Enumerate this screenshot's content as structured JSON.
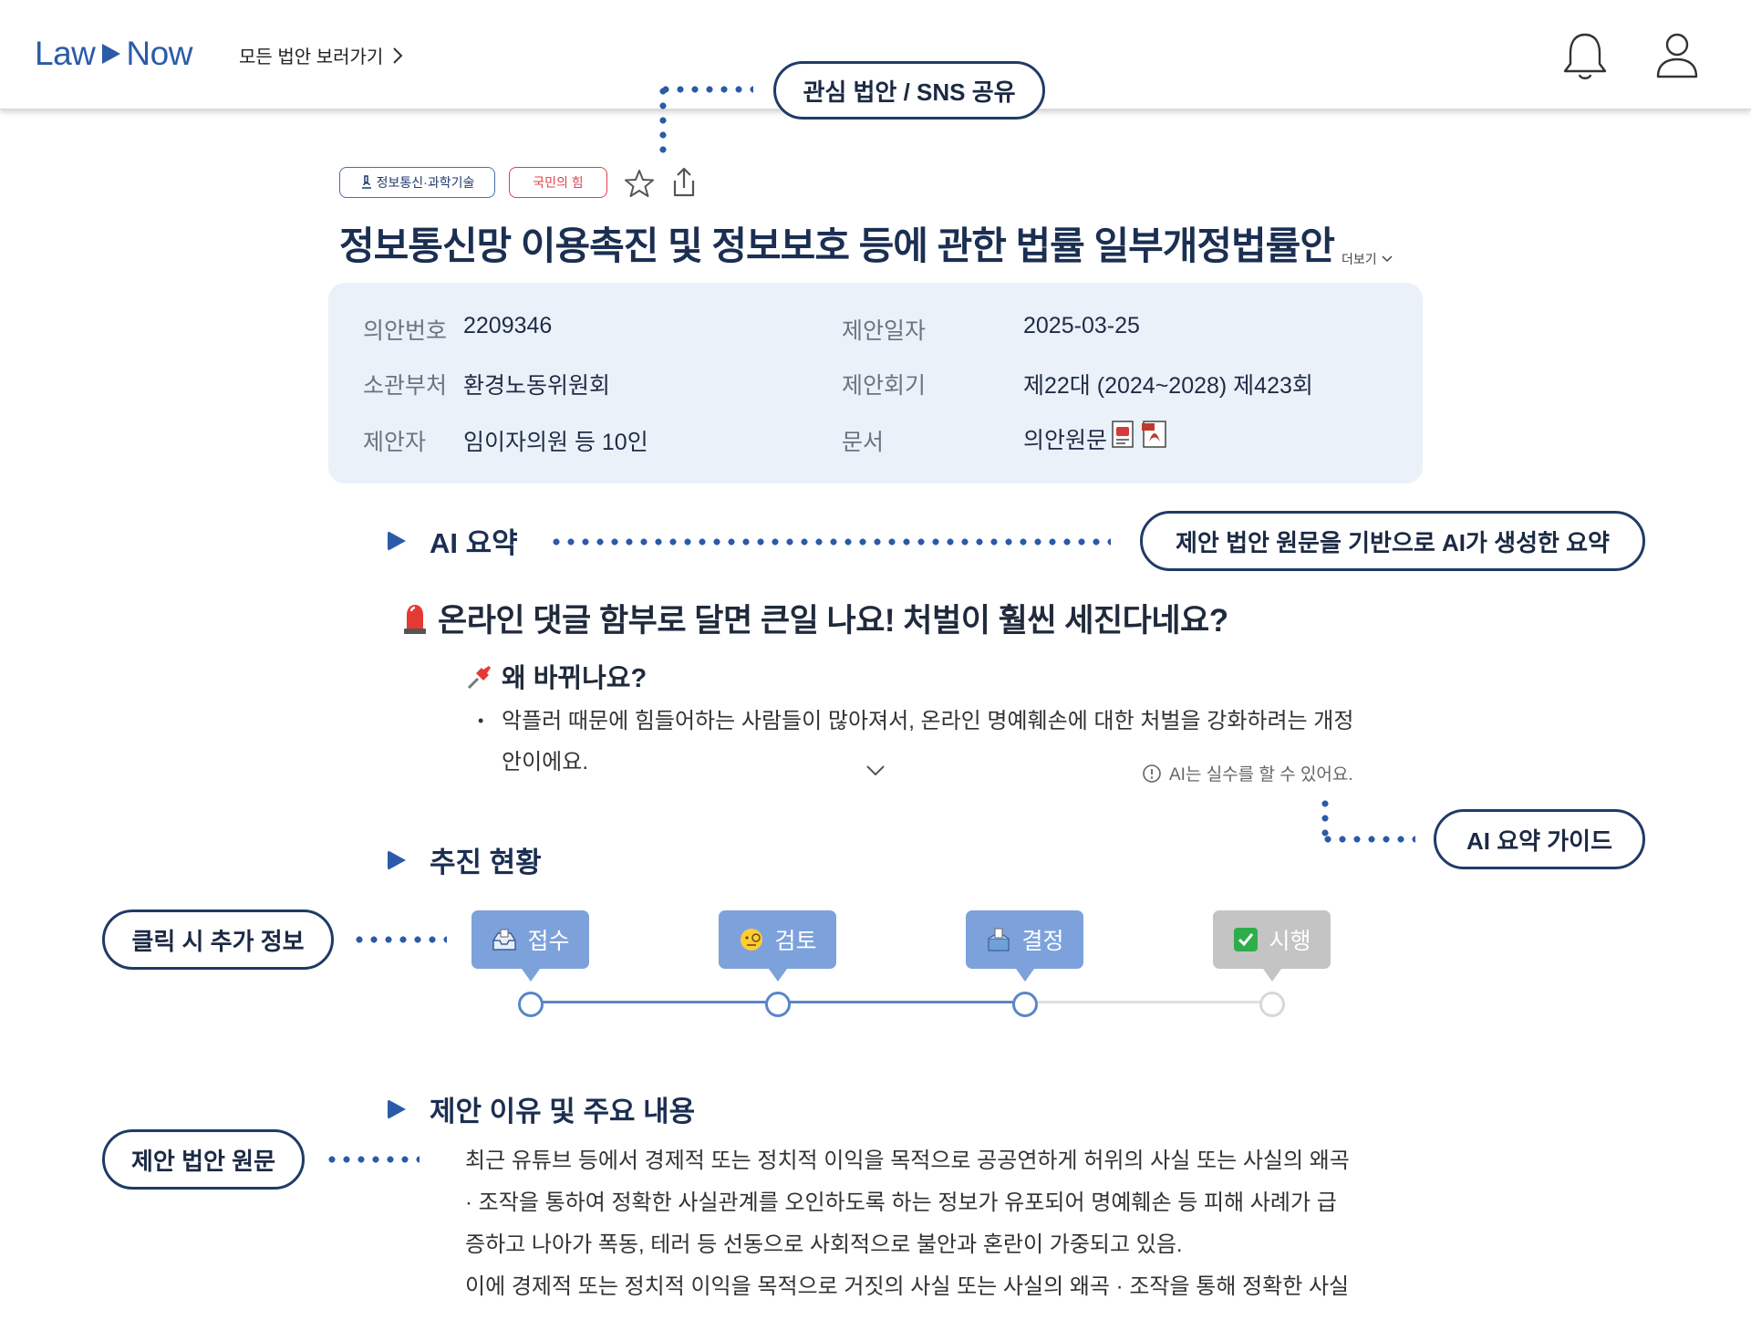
{
  "header": {
    "logo_left": "Law",
    "logo_right": "Now",
    "all_bills_label": "모든 법안 보러가기"
  },
  "callouts": {
    "share": "관심 법안 / SNS 공유",
    "ai_source": "제안 법안 원문을 기반으로 AI가 생성한 요약",
    "ai_guide": "AI 요약 가이드",
    "click_info": "클릭 시 추가 정보",
    "original": "제안 법안 원문"
  },
  "bill": {
    "field_tag": "정보통신·과학기술",
    "party_tag": "국민의 힘",
    "title": "정보통신망 이용촉진 및 정보보호 등에 관한 법률 일부개정법률안",
    "more_label": "더보기"
  },
  "info": {
    "bill_no_label": "의안번호",
    "bill_no": "2209346",
    "date_label": "제안일자",
    "date": "2025-03-25",
    "committee_label": "소관부처",
    "committee": "환경노동위원회",
    "session_label": "제안회기",
    "session": "제22대 (2024~2028) 제423회",
    "proposer_label": "제안자",
    "proposer": "임이자의원 등 10인",
    "doc_label": "문서",
    "doc": "의안원문"
  },
  "ai_summary": {
    "section_title": "AI 요약",
    "headline": "온라인 댓글 함부로 달면 큰일 나요! 처벌이 훨씬 세진다네요?",
    "sub_title": "왜 바뀌나요?",
    "bullet": "악플러 때문에 힘들어하는 사람들이 많아져서, 온라인 명예훼손에 대한 처벌을 강화하려는 개정안이에요.",
    "warning": "AI는 실수를 할 수 있어요."
  },
  "progress": {
    "section_title": "추진 현황",
    "steps": [
      {
        "label": "접수",
        "icon": "inbox-tray-icon",
        "active": true
      },
      {
        "label": "검토",
        "icon": "monocle-face-icon",
        "active": true
      },
      {
        "label": "결정",
        "icon": "ballot-box-icon",
        "active": true
      },
      {
        "label": "시행",
        "icon": "check-mark-button-icon",
        "active": false
      }
    ]
  },
  "proposal": {
    "section_title": "제안 이유 및 주요 내용",
    "para1_line1": "최근 유튜브 등에서 경제적 또는 정치적 이익을 목적으로 공공연하게 허위의 사실 또는 사실의 왜곡",
    "para1_line2": "· 조작을 통하여 정확한 사실관계를 오인하도록 하는 정보가 유포되어 명예훼손 등 피해 사례가 급",
    "para1_line3": "증하고 나아가 폭동, 테러 등 선동으로 사회적으로 불안과 혼란이 가중되고 있음.",
    "para2_line1": "이에 경제적 또는 정치적 이익을 목적으로 거짓의 사실 또는 사실의 왜곡 · 조작을 통해 정확한 사실"
  },
  "colors": {
    "brand": "#2b5ba8",
    "title": "#1b2f52",
    "card_bg": "#ebf1f9",
    "step_active": "#7da2db",
    "step_inactive": "#c4c4c4",
    "party_red": "#e0414b"
  }
}
